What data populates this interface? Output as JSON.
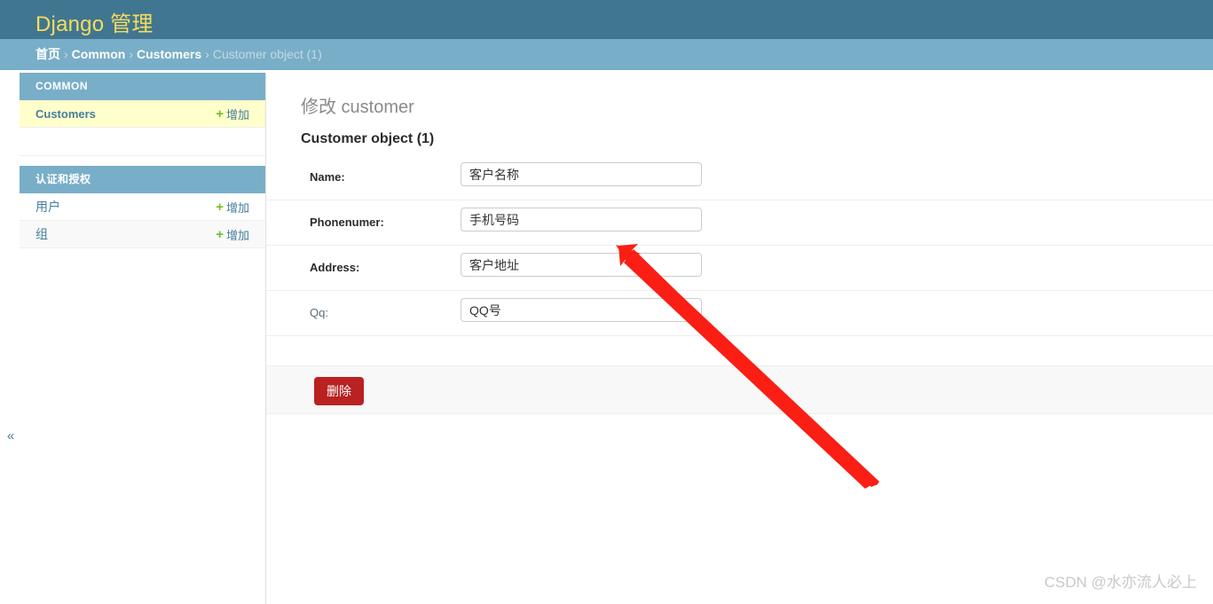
{
  "header": {
    "branding": "Django 管理"
  },
  "breadcrumbs": {
    "separator": "›",
    "items": [
      {
        "label": "首页",
        "current": false
      },
      {
        "label": "Common",
        "current": false
      },
      {
        "label": "Customers",
        "current": false
      },
      {
        "label": "Customer object (1)",
        "current": true
      }
    ]
  },
  "sidebar": {
    "toggle_icon": "«",
    "add_label": "增加",
    "plus_icon": "+",
    "modules": [
      {
        "caption": "COMMON",
        "models": [
          {
            "name": "Customers",
            "current": true,
            "add_label": "增加"
          }
        ]
      },
      {
        "caption": "认证和授权",
        "models": [
          {
            "name": "用户",
            "current": false,
            "add_label": "增加"
          },
          {
            "name": "组",
            "current": false,
            "add_label": "增加"
          }
        ]
      }
    ]
  },
  "content": {
    "title": "修改 customer",
    "object_title": "Customer object (1)",
    "fields": [
      {
        "label": "Name:",
        "value": "客户名称",
        "required": true
      },
      {
        "label": "Phonenumer:",
        "value": "手机号码",
        "required": true
      },
      {
        "label": "Address:",
        "value": "客户地址",
        "required": true
      },
      {
        "label": "Qq:",
        "value": "QQ号",
        "required": false
      }
    ],
    "submit_row": {
      "delete_label": "删除"
    }
  },
  "annotation": {
    "arrow_color": "#fa1e14"
  },
  "watermark": {
    "text": "CSDN @水亦流人必上"
  }
}
